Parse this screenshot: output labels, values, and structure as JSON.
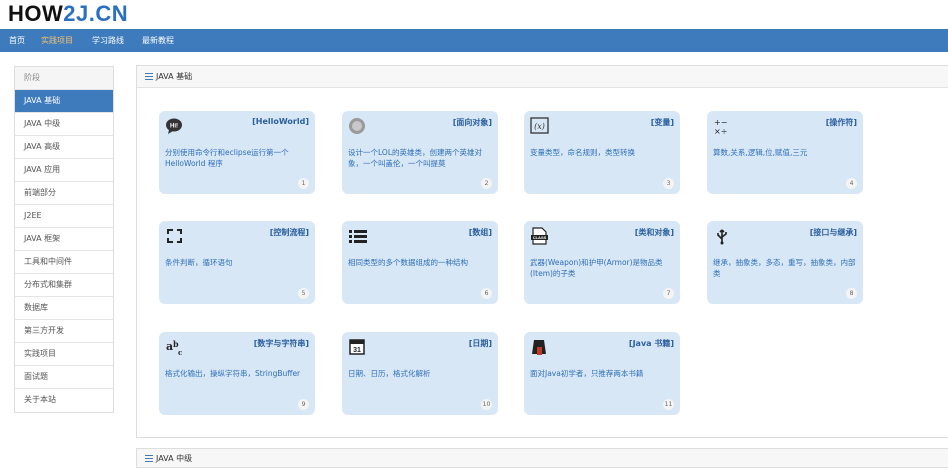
{
  "logo": {
    "part1": "HOW",
    "part2": "2J",
    "part3": ".CN"
  },
  "nav": [
    {
      "label": "首页"
    },
    {
      "label": "实践项目"
    },
    {
      "label": "学习路线"
    },
    {
      "label": "最新教程"
    }
  ],
  "sidebar": {
    "items": [
      {
        "label": "阶段"
      },
      {
        "label": "JAVA 基础"
      },
      {
        "label": "JAVA 中级"
      },
      {
        "label": "JAVA 高级"
      },
      {
        "label": "JAVA 应用"
      },
      {
        "label": "前端部分"
      },
      {
        "label": "J2EE"
      },
      {
        "label": "JAVA 框架"
      },
      {
        "label": "工具和中间件"
      },
      {
        "label": "分布式和集群"
      },
      {
        "label": "数据库"
      },
      {
        "label": "第三方开发"
      },
      {
        "label": "实践项目"
      },
      {
        "label": "面试题"
      },
      {
        "label": "关于本站"
      }
    ]
  },
  "panel": {
    "title": "JAVA 基础"
  },
  "panel2": {
    "title": "JAVA 中级"
  },
  "cards": [
    {
      "title": "[HelloWorld]",
      "desc": "分别使用命令行和eclipse运行第一个HelloWorld 程序",
      "num": "1",
      "icon": "hi-speech-bubble-icon"
    },
    {
      "title": "[面向对象]",
      "desc": "设计一个LOL的英雄类，创建两个英雄对象，一个叫盖伦，一个叫提莫",
      "num": "2",
      "icon": "hero-avatar-icon"
    },
    {
      "title": "[变量]",
      "desc": "变量类型，命名规则，类型转换",
      "num": "3",
      "icon": "variable-x-icon"
    },
    {
      "title": "[操作符]",
      "desc": "算数,关系,逻辑,位,赋值,三元",
      "num": "4",
      "icon": "operators-icon"
    },
    {
      "title": "[控制流程]",
      "desc": "条件判断，循环语句",
      "num": "5",
      "icon": "loop-arrows-icon"
    },
    {
      "title": "[数组]",
      "desc": "相同类型的多个数据组成的一种结构",
      "num": "6",
      "icon": "list-icon"
    },
    {
      "title": "[类和对象]",
      "desc": "武器(Weapon)和护甲(Armor)是物品类(Item)的子类",
      "num": "7",
      "icon": "class-file-icon"
    },
    {
      "title": "[接口与继承]",
      "desc": "继承，抽象类，多态，重写，抽象类，内部类",
      "num": "8",
      "icon": "usb-icon"
    },
    {
      "title": "[数字与字符串]",
      "desc": "格式化输出，操纵字符串，StringBuffer",
      "num": "9",
      "icon": "abc-icon"
    },
    {
      "title": "[日期]",
      "desc": "日期、日历，格式化解析",
      "num": "10",
      "icon": "calendar-icon"
    },
    {
      "title": "[Java 书籍]",
      "desc": "面对Java初学者，只推荐两本书籍",
      "num": "11",
      "icon": "book-icon"
    }
  ]
}
